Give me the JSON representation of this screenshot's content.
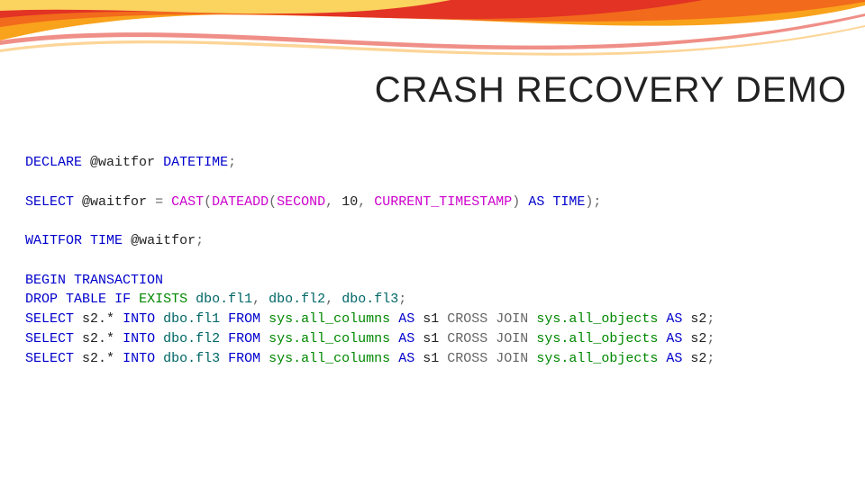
{
  "title": "CRASH RECOVERY DEMO",
  "kw": {
    "declare": "DECLARE",
    "datetime": "DATETIME",
    "select": "SELECT",
    "as": "AS",
    "time": "TIME",
    "waitfor": "WAITFOR",
    "begin": "BEGIN",
    "transaction": "TRANSACTION",
    "drop": "DROP",
    "table": "TABLE",
    "if": "IF",
    "exists": "EXISTS",
    "into": "INTO",
    "from": "FROM",
    "cross": "CROSS",
    "join": "JOIN"
  },
  "fn": {
    "cast": "CAST",
    "dateadd": "DATEADD",
    "second": "SECOND",
    "current_timestamp": "CURRENT_TIMESTAMP"
  },
  "var": {
    "waitfor": "@waitfor"
  },
  "num": {
    "ten": "10"
  },
  "objs": {
    "dbo_fl1": "dbo.fl1",
    "dbo_fl2": "dbo.fl2",
    "dbo_fl3": "dbo.fl3",
    "sys_all_columns": "sys.all_columns",
    "sys_all_objects": "sys.all_objects"
  },
  "alias": {
    "s1": "s1",
    "s2": "s2"
  },
  "star": "s2.*",
  "pun": {
    "semi": ";",
    "comma": ",",
    "eq": "=",
    "lp": "(",
    "rp": ")"
  }
}
